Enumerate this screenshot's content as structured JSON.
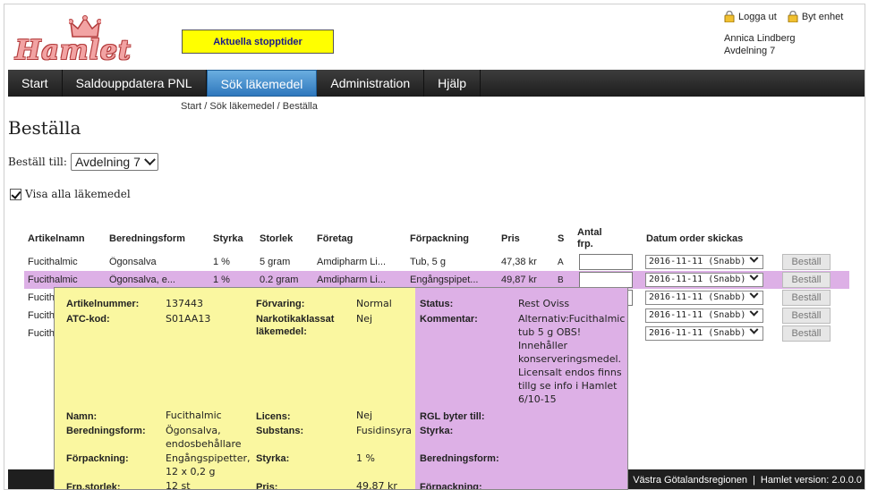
{
  "header": {
    "logo_text": "Hamlet",
    "stop_button": "Aktuella stopptider",
    "logout": "Logga ut",
    "switch_unit": "Byt enhet",
    "user_name": "Annica Lindberg",
    "user_unit": "Avdelning 7"
  },
  "nav": {
    "items": [
      "Start",
      "Saldouppdatera PNL",
      "Sök läkemedel",
      "Administration",
      "Hjälp"
    ],
    "active": "Sök läkemedel"
  },
  "breadcrumb": [
    "Start",
    "Sök läkemedel",
    "Beställa"
  ],
  "page_title": "Beställa",
  "order_to": {
    "label": "Beställ till:",
    "value": "Avdelning 7"
  },
  "show_all": {
    "label": "Visa alla läkemedel",
    "checked": true
  },
  "table": {
    "headers": [
      "Artikelnamn",
      "Beredningsform",
      "Styrka",
      "Storlek",
      "Företag",
      "Förpackning",
      "Pris",
      "S",
      "Antal frp.",
      "Datum order skickas"
    ],
    "rows": [
      {
        "name": "Fucithalmic",
        "form": "Ögonsalva",
        "strength": "1 %",
        "size": "5 gram",
        "company": "Amdipharm Li...",
        "package": "Tub, 5 g",
        "price": "47,38 kr",
        "s": "A",
        "date": "2016-11-11 (Snabb)",
        "button": "Beställ",
        "highlight": false
      },
      {
        "name": "Fucithalmic",
        "form": "Ögonsalva, e...",
        "strength": "1 %",
        "size": "0.2 gram",
        "company": "Amdipharm Li...",
        "package": "Engångspipet...",
        "price": "49,87 kr",
        "s": "B",
        "date": "2016-11-11 (Snabb)",
        "button": "Beställ",
        "highlight": true
      },
      {
        "name": "Fucithalmic",
        "date": "2016-11-11 (Snabb)",
        "button": "Beställ",
        "highlight": false
      },
      {
        "name": "Fucithalmic",
        "date": "2016-11-11 (Snabb)",
        "button": "Beställ",
        "highlight": false
      },
      {
        "name": "Fucithalmic",
        "date": "2016-11-11 (Snabb)",
        "button": "Beställ",
        "highlight": false
      }
    ]
  },
  "popup": {
    "article_number_label": "Artikelnummer:",
    "article_number": "137443",
    "storage_label": "Förvaring:",
    "storage": "Normal",
    "status_label": "Status:",
    "status": "Rest Oviss",
    "atc_label": "ATC-kod:",
    "atc": "S01AA13",
    "narcotic_label": "Narkotikaklassat läkemedel:",
    "narcotic": "Nej",
    "comment_label": "Kommentar:",
    "comment": "Alternativ:Fucithalmic tub 5 g OBS! Innehåller konserveringsmedel. Licensalt endos finns tillg se info i Hamlet 6/10-15",
    "name_label": "Namn:",
    "name": "Fucithalmic",
    "license_label": "Licens:",
    "license": "Nej",
    "rgl_label": "RGL byter till:",
    "form_label": "Beredningsform:",
    "form": "Ögonsalva, endosbehållare",
    "substance_label": "Substans:",
    "substance": "Fusidinsyra",
    "right_strength_label": "Styrka:",
    "package_label": "Förpackning:",
    "package": "Engångspipetter, 12 x 0,2 g",
    "strength_label": "Styrka:",
    "strength": "1 %",
    "right_form_label": "Beredningsform:",
    "frp_size_label": "Frp.storlek:",
    "frp_size": "12 st",
    "price_label": "Pris:",
    "price": "49,87 kr",
    "right_package_label": "Förpackning:"
  },
  "footer": {
    "region": "Västra Götalandsregionen",
    "version": "Hamlet version: 2.0.0.0"
  }
}
